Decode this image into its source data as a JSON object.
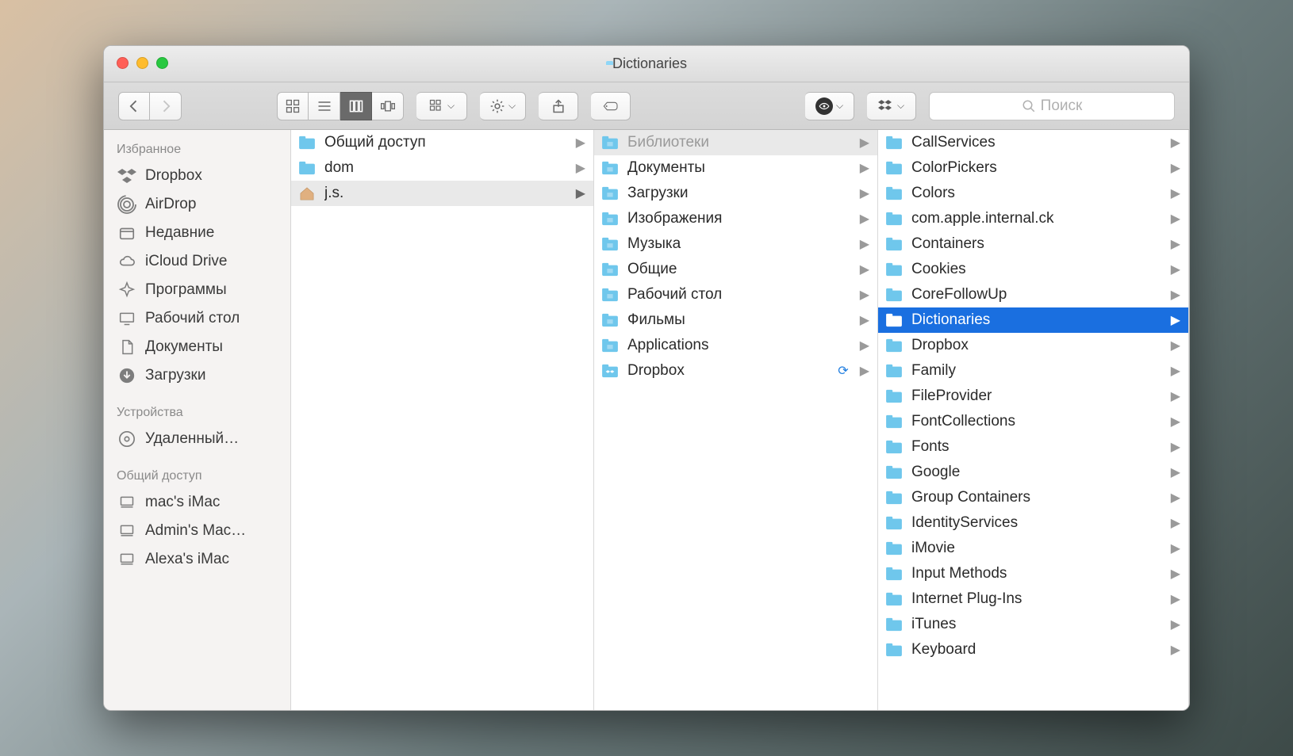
{
  "window": {
    "title": "Dictionaries"
  },
  "search": {
    "placeholder": "Поиск"
  },
  "sidebar": {
    "sections": [
      {
        "header": "Избранное",
        "items": [
          {
            "icon": "dropbox",
            "label": "Dropbox"
          },
          {
            "icon": "airdrop",
            "label": "AirDrop"
          },
          {
            "icon": "recent",
            "label": "Недавние"
          },
          {
            "icon": "icloud",
            "label": "iCloud Drive"
          },
          {
            "icon": "apps",
            "label": "Программы"
          },
          {
            "icon": "desktop",
            "label": "Рабочий стол"
          },
          {
            "icon": "documents",
            "label": "Документы"
          },
          {
            "icon": "downloads",
            "label": "Загрузки"
          }
        ]
      },
      {
        "header": "Устройства",
        "items": [
          {
            "icon": "disc",
            "label": "Удаленный…"
          }
        ]
      },
      {
        "header": "Общий доступ",
        "items": [
          {
            "icon": "comp",
            "label": " mac's iMac"
          },
          {
            "icon": "comp",
            "label": "Admin's Mac…"
          },
          {
            "icon": "comp",
            "label": "Alexa's iMac"
          }
        ]
      }
    ]
  },
  "columns": [
    {
      "items": [
        {
          "icon": "folder",
          "label": "Общий доступ",
          "arrow": true
        },
        {
          "icon": "folder",
          "label": "dom",
          "arrow": true
        },
        {
          "icon": "home",
          "label": "j.s.",
          "arrow": true,
          "selected": "gray"
        }
      ]
    },
    {
      "items": [
        {
          "icon": "folder-sys",
          "label": "Библиотеки",
          "arrow": true,
          "selected": "gray-dim"
        },
        {
          "icon": "folder-sys",
          "label": "Документы",
          "arrow": true
        },
        {
          "icon": "folder-sys",
          "label": "Загрузки",
          "arrow": true
        },
        {
          "icon": "folder-sys",
          "label": "Изображения",
          "arrow": true
        },
        {
          "icon": "folder-sys",
          "label": "Музыка",
          "arrow": true
        },
        {
          "icon": "folder-sys",
          "label": "Общие",
          "arrow": true
        },
        {
          "icon": "folder-sys",
          "label": "Рабочий стол",
          "arrow": true
        },
        {
          "icon": "folder-sys",
          "label": "Фильмы",
          "arrow": true
        },
        {
          "icon": "folder-sys",
          "label": "Applications",
          "arrow": true
        },
        {
          "icon": "dropbox-folder",
          "label": "Dropbox",
          "arrow": true,
          "sync": true
        }
      ]
    },
    {
      "items": [
        {
          "icon": "folder",
          "label": "CallServices",
          "arrow": true
        },
        {
          "icon": "folder",
          "label": "ColorPickers",
          "arrow": true
        },
        {
          "icon": "folder",
          "label": "Colors",
          "arrow": true
        },
        {
          "icon": "folder",
          "label": "com.apple.internal.ck",
          "arrow": true
        },
        {
          "icon": "folder",
          "label": "Containers",
          "arrow": true
        },
        {
          "icon": "folder",
          "label": "Cookies",
          "arrow": true
        },
        {
          "icon": "folder",
          "label": "CoreFollowUp",
          "arrow": true
        },
        {
          "icon": "folder",
          "label": "Dictionaries",
          "arrow": true,
          "selected": "blue"
        },
        {
          "icon": "folder",
          "label": "Dropbox",
          "arrow": true
        },
        {
          "icon": "folder",
          "label": "Family",
          "arrow": true
        },
        {
          "icon": "folder",
          "label": "FileProvider",
          "arrow": true
        },
        {
          "icon": "folder",
          "label": "FontCollections",
          "arrow": true
        },
        {
          "icon": "folder",
          "label": "Fonts",
          "arrow": true
        },
        {
          "icon": "folder",
          "label": "Google",
          "arrow": true
        },
        {
          "icon": "folder",
          "label": "Group Containers",
          "arrow": true
        },
        {
          "icon": "folder",
          "label": "IdentityServices",
          "arrow": true
        },
        {
          "icon": "folder",
          "label": "iMovie",
          "arrow": true
        },
        {
          "icon": "folder",
          "label": "Input Methods",
          "arrow": true
        },
        {
          "icon": "folder",
          "label": "Internet Plug-Ins",
          "arrow": true
        },
        {
          "icon": "folder",
          "label": "iTunes",
          "arrow": true
        },
        {
          "icon": "folder",
          "label": "Keyboard",
          "arrow": true
        }
      ]
    }
  ]
}
